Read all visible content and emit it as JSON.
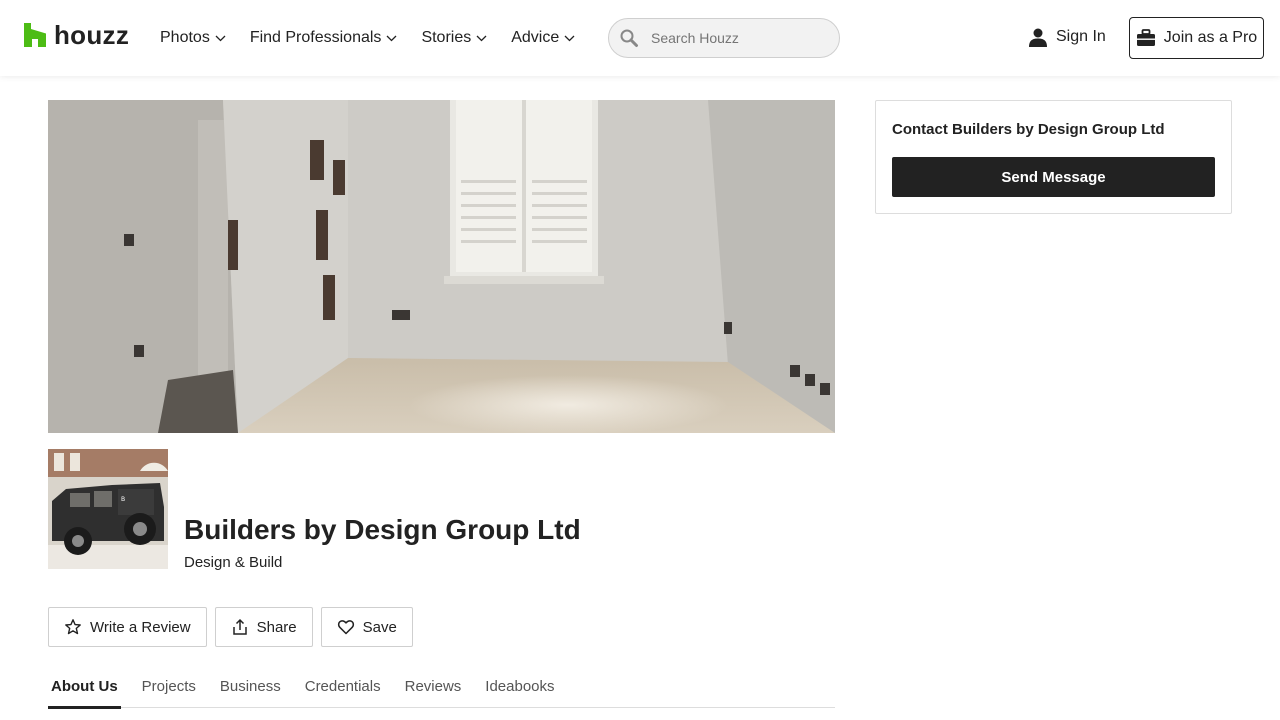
{
  "header": {
    "logo_text": "houzz",
    "nav": [
      {
        "label": "Photos"
      },
      {
        "label": "Find Professionals"
      },
      {
        "label": "Stories"
      },
      {
        "label": "Advice"
      }
    ],
    "search_placeholder": "Search Houzz",
    "sign_in_label": "Sign In",
    "join_pro_label": "Join as a Pro"
  },
  "contact": {
    "title": "Contact Builders by Design Group Ltd",
    "send_label": "Send Message"
  },
  "profile": {
    "name": "Builders by Design Group Ltd",
    "category": "Design & Build"
  },
  "actions": {
    "review_label": "Write a Review",
    "share_label": "Share",
    "save_label": "Save"
  },
  "tabs": [
    {
      "label": "About Us",
      "active": true
    },
    {
      "label": "Projects",
      "active": false
    },
    {
      "label": "Business",
      "active": false
    },
    {
      "label": "Credentials",
      "active": false
    },
    {
      "label": "Reviews",
      "active": false
    },
    {
      "label": "Ideabooks",
      "active": false
    }
  ],
  "colors": {
    "brand_green": "#4dbc15",
    "dark": "#222222"
  },
  "icons": {
    "logo": "houzz-logo-icon",
    "chevron": "chevron-down-icon",
    "search": "search-icon",
    "user": "user-icon",
    "briefcase": "briefcase-icon",
    "star": "star-icon",
    "share": "share-icon",
    "heart": "heart-icon"
  }
}
